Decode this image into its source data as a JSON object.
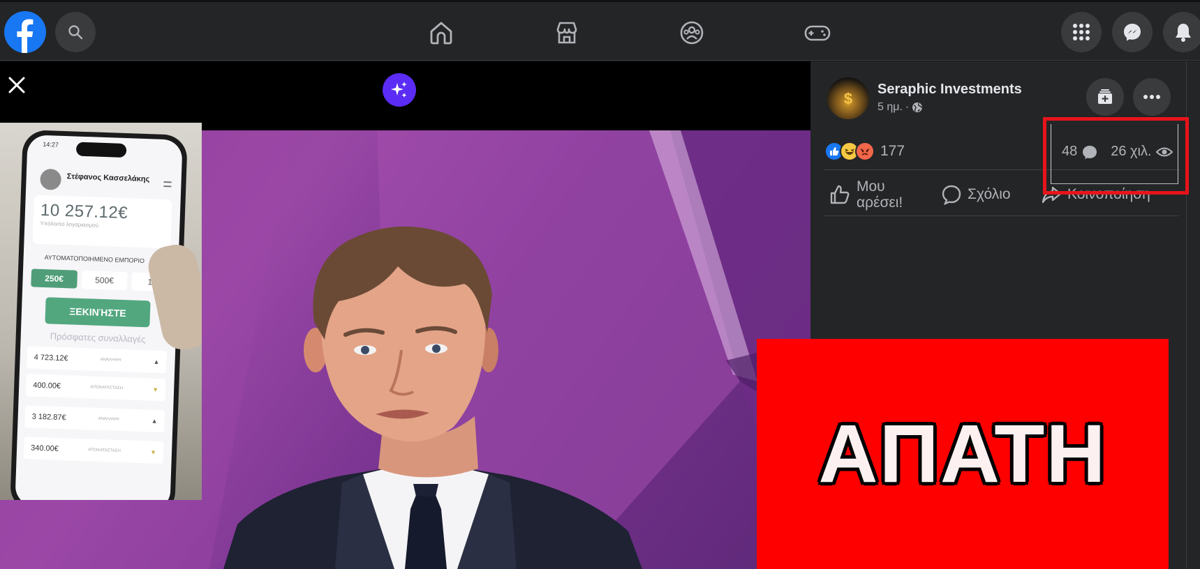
{
  "topbar": {
    "logo_icon": "facebook-logo-icon",
    "search_icon": "search-icon",
    "nav_icons": [
      "home-icon",
      "marketplace-icon",
      "groups-icon",
      "gaming-icon"
    ],
    "right_icons": [
      "menu-grid-icon",
      "messenger-icon",
      "notifications-icon"
    ],
    "brand_color": "#1877f2"
  },
  "viewer": {
    "close_icon": "close-icon",
    "ai_icon": "sparkle-icon",
    "ai_color": "#5b2cf5"
  },
  "phone": {
    "time": "14:27",
    "user_name": "Στέφανος Κασσελάκης",
    "balance": "10 257.12€",
    "balance_label": "Υπόλοιπο λογαριασμού",
    "automated_trading": "ΑΥΤΟΜΑΤΟΠΟΙΗΜΕΝΟ ΕΜΠΟΡΙΟ",
    "amounts": [
      "250€",
      "500€",
      "100"
    ],
    "start_button": "ΞΕΚΙΝΉΣΤΕ",
    "recent_label": "Πρόσφατες συναλλαγές",
    "transactions": [
      {
        "value": "4 723.12€",
        "type": "ΑΝΑΛΗΨΗ",
        "arrow": "▲"
      },
      {
        "value": "400.00€",
        "type": "ΑΠΟΚΑΤΑΣΤΑΣΗ",
        "arrow": "▼"
      },
      {
        "value": "3 182.87€",
        "type": "ΑΝΑΛΗΨΗ",
        "arrow": "▲"
      },
      {
        "value": "340.00€",
        "type": "ΑΠΟΚΑΤΑΣΤΑΣΗ",
        "arrow": "▼"
      }
    ]
  },
  "overlay": {
    "scam_text": "ΑΠΑΤΗ",
    "scam_bg": "#fe0000"
  },
  "post": {
    "page_name": "Seraphic Investments",
    "time": "5 ημ.",
    "privacy_icon": "globe-icon",
    "save_icon": "save-collection-icon",
    "more_icon": "more-options-icon",
    "reactions": [
      "like",
      "haha",
      "angry"
    ],
    "reaction_count": "177",
    "comment_count": "48",
    "comment_icon": "comment-bubble-icon",
    "view_count": "26 χιλ.",
    "view_icon": "eye-icon",
    "actions": {
      "like": "Μου αρέσει!",
      "comment": "Σχόλιο",
      "share": "Κοινοποίηση"
    },
    "highlight_color": "#e8141b"
  }
}
